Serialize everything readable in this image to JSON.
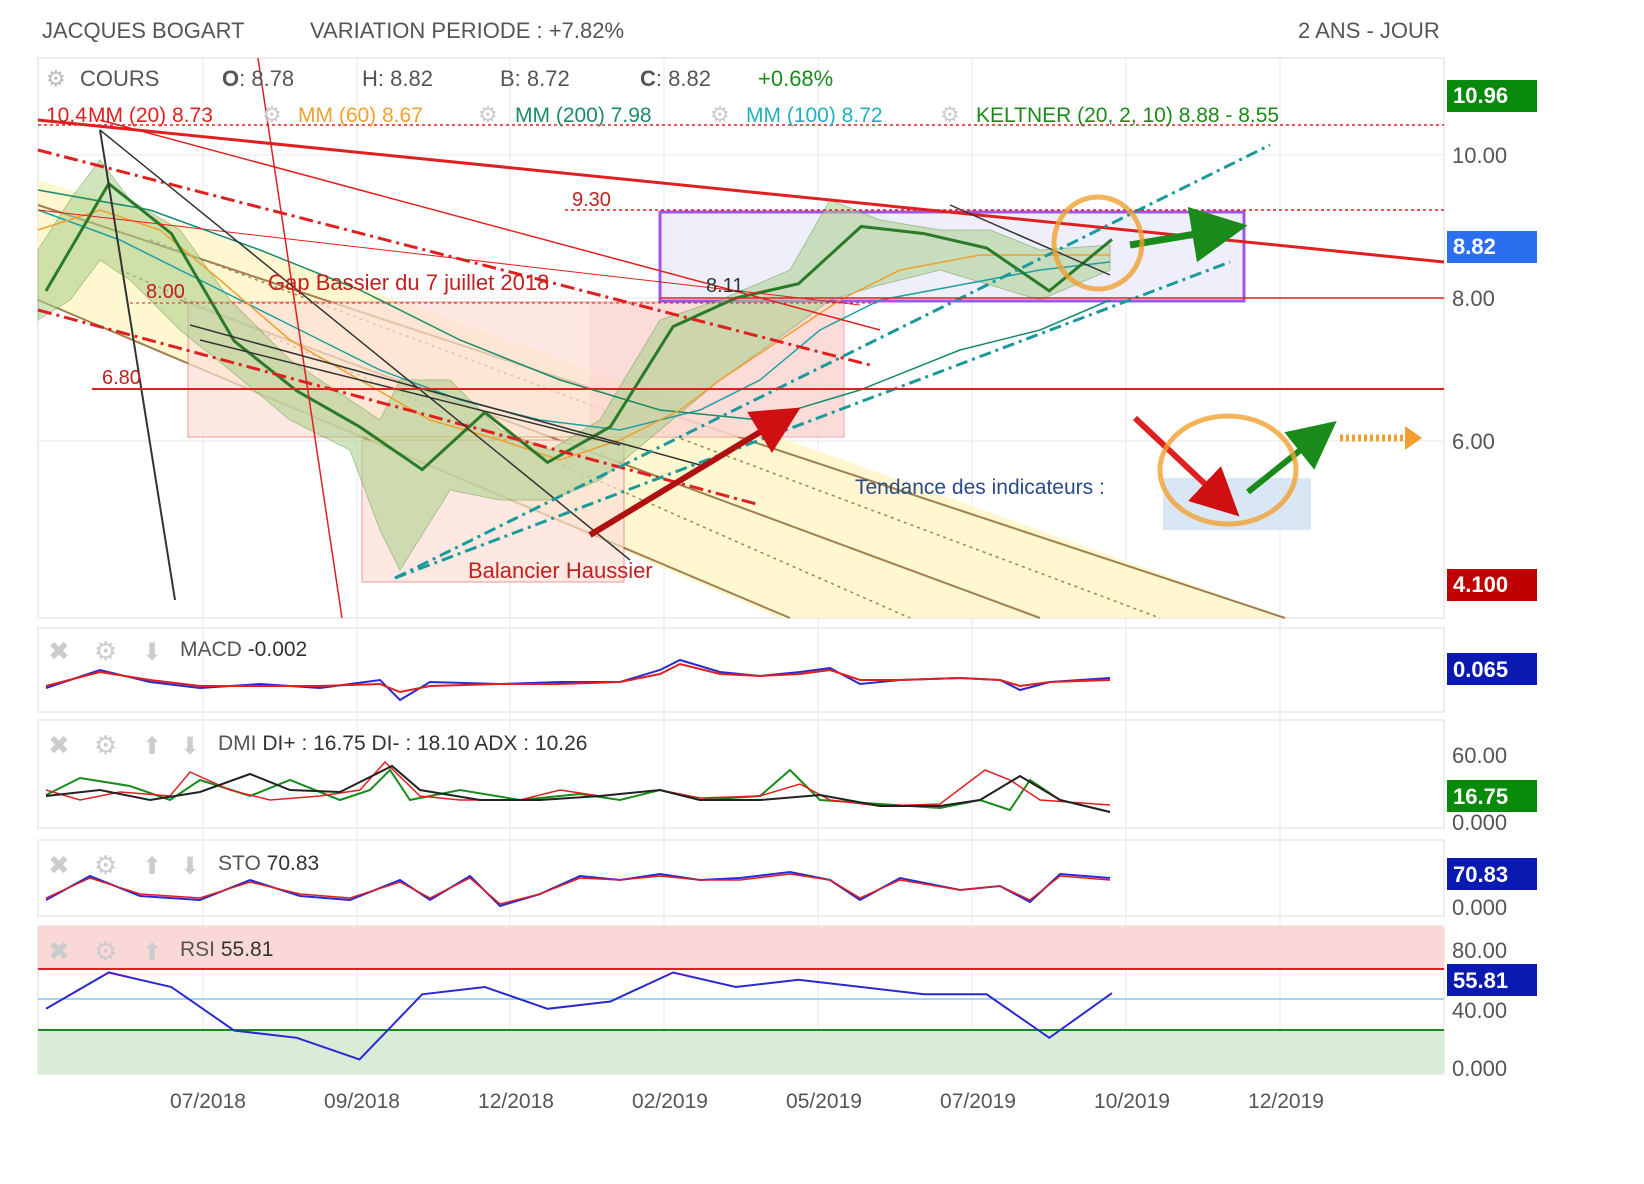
{
  "header": {
    "title": "JACQUES BOGART",
    "variation": "VARIATION PERIODE : +7.82%",
    "period": "2 ANS - JOUR"
  },
  "ohlc": {
    "label": "COURS",
    "o_key": "O",
    "o": ": 8.78",
    "h": "H: 8.82",
    "b": "B: 8.72",
    "c_key": "C",
    "c": ": 8.82",
    "change": "+0.68%"
  },
  "indicators": {
    "mm20": "MM (20) 8.73",
    "mm60": "MM (60) 8.67",
    "mm200": "MM (200) 7.98",
    "mm100": "MM (100) 8.72",
    "keltner": "KELTNER (20, 2, 10) 8.88 - 8.55",
    "high_marker": "10.4"
  },
  "annotations": {
    "gap": "Gap Bassier du 7 juillet 2018",
    "balancier": "Balancier Haussier",
    "tendance": "Tendance des indicateurs :",
    "l930": "9.30",
    "l811": "8.11",
    "l800": "8.00",
    "l680": "6.80"
  },
  "badges": {
    "max": "10.96",
    "last": "8.82",
    "min": "4.100",
    "macd": "0.065",
    "dmi": "16.75",
    "sto": "70.83",
    "rsi": "55.81"
  },
  "y_ticks_price": [
    "10.00",
    "8.00",
    "6.00"
  ],
  "panels": {
    "macd": {
      "label": "MACD",
      "value": "-0.002"
    },
    "dmi": {
      "label": "DMI",
      "value": "DI+ : 16.75 DI- : 18.10 ADX : 10.26",
      "ticks": [
        "60.00",
        "0.000"
      ]
    },
    "sto": {
      "label": "STO",
      "value": "70.83",
      "ticks": [
        "0.000"
      ]
    },
    "rsi": {
      "label": "RSI",
      "value": "55.81",
      "ticks": [
        "80.00",
        "40.00",
        "0.000"
      ]
    }
  },
  "x_ticks": [
    "07/2018",
    "09/2018",
    "12/2018",
    "02/2019",
    "05/2019",
    "07/2019",
    "10/2019",
    "12/2019"
  ],
  "colors": {
    "red": "#e02020",
    "green": "#1a8a1a",
    "blue": "#2a2ad0",
    "orange": "#f0a030",
    "purple": "#8a2be2",
    "teal": "#20a0a0",
    "badge_green": "#0a8a0a",
    "badge_blue": "#2b6ff0",
    "badge_red": "#c00000",
    "badge_navy": "#0a1ab0"
  },
  "chart_data": {
    "type": "line",
    "title": "JACQUES BOGART",
    "ylim": [
      4.1,
      10.96
    ],
    "x": [
      "2018-04",
      "2018-05",
      "2018-06",
      "2018-07",
      "2018-08",
      "2018-09",
      "2018-10",
      "2018-11",
      "2018-12",
      "2019-01",
      "2019-02",
      "2019-03",
      "2019-04",
      "2019-05",
      "2019-06",
      "2019-07",
      "2019-08",
      "2019-09"
    ],
    "series": [
      {
        "name": "COURS",
        "values": [
          8.1,
          9.6,
          8.9,
          7.4,
          6.7,
          6.2,
          5.6,
          6.4,
          5.7,
          6.2,
          7.6,
          8.0,
          8.2,
          9.0,
          8.9,
          8.7,
          8.1,
          8.82
        ]
      }
    ],
    "rsi": [
      45,
      70,
      60,
      30,
      25,
      10,
      55,
      60,
      45,
      50,
      70,
      60,
      65,
      60,
      55,
      55,
      25,
      55.81
    ]
  }
}
